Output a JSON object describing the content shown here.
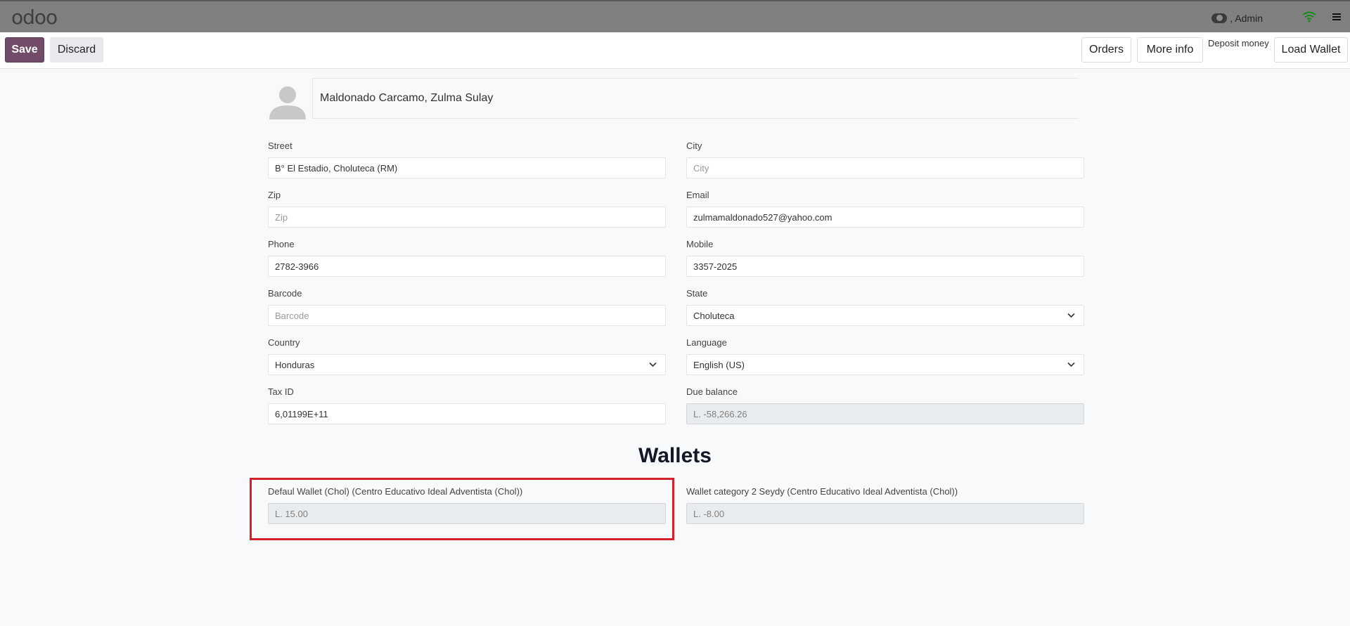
{
  "topbar": {
    "logo": "odoo",
    "user_label": ", Admin"
  },
  "controls": {
    "save_label": "Save",
    "discard_label": "Discard",
    "orders_label": "Orders",
    "more_info_label": "More info",
    "deposit_label": "Deposit money",
    "load_wallet_label": "Load Wallet"
  },
  "partner": {
    "name": "Maldonado Carcamo, Zulma Sulay"
  },
  "fields": {
    "street": {
      "label": "Street",
      "value": "B° El Estadio, Choluteca (RM)"
    },
    "city": {
      "label": "City",
      "placeholder": "City"
    },
    "zip": {
      "label": "Zip",
      "placeholder": "Zip"
    },
    "email": {
      "label": "Email",
      "value": "zulmamaldonado527@yahoo.com"
    },
    "phone": {
      "label": "Phone",
      "value": "2782-3966"
    },
    "mobile": {
      "label": "Mobile",
      "value": "3357-2025"
    },
    "barcode": {
      "label": "Barcode",
      "placeholder": "Barcode"
    },
    "state": {
      "label": "State",
      "value": "Choluteca"
    },
    "country": {
      "label": "Country",
      "value": "Honduras"
    },
    "language": {
      "label": "Language",
      "value": "English (US)"
    },
    "tax_id": {
      "label": "Tax ID",
      "value": "6,01199E+11"
    },
    "due_balance": {
      "label": "Due balance",
      "value": "L. -58,266.26"
    }
  },
  "wallets": {
    "title": "Wallets",
    "items": [
      {
        "label": "Defaul Wallet (Chol) (Centro Educativo Ideal Adventista (Chol))",
        "value": "L. 15.00"
      },
      {
        "label": "Wallet category 2 Seydy (Centro Educativo Ideal Adventista (Chol))",
        "value": "L. -8.00"
      }
    ]
  },
  "colors": {
    "primary": "#714b67",
    "topbar": "#808080",
    "highlight": "#d3212a"
  }
}
